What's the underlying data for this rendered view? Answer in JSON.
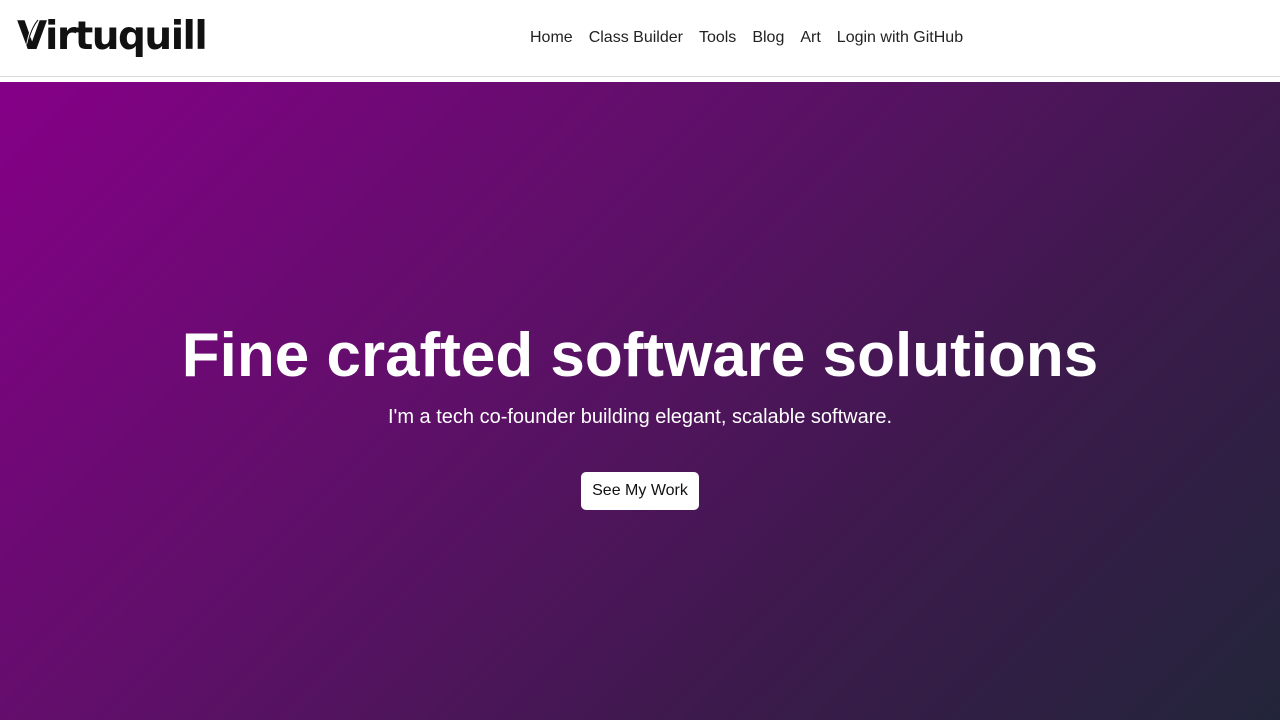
{
  "brand": {
    "name": "Virtuquill"
  },
  "nav": {
    "items": [
      {
        "label": "Home"
      },
      {
        "label": "Class Builder"
      },
      {
        "label": "Tools"
      },
      {
        "label": "Blog"
      },
      {
        "label": "Art"
      },
      {
        "label": "Login with GitHub"
      }
    ]
  },
  "hero": {
    "title": "Fine crafted software solutions",
    "subtitle": "I'm a tech co-founder building elegant, scalable software.",
    "cta_label": "See My Work",
    "gradient_start": "#850087",
    "gradient_end": "#22253a"
  },
  "icons": {
    "logo_quill": "quill-icon"
  },
  "colors": {
    "nav_background": "#ffffff",
    "nav_text": "#222222",
    "hero_text": "#ffffff",
    "button_background": "#ffffff"
  }
}
